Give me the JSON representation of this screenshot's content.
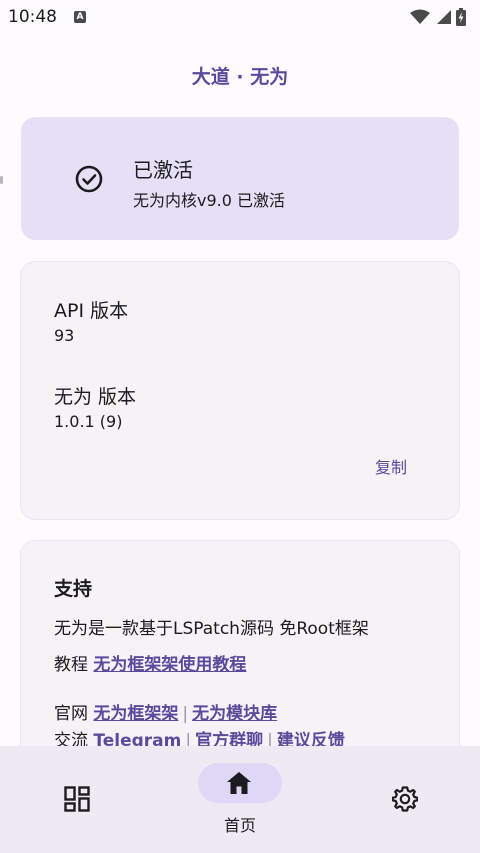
{
  "status_bar": {
    "time": "10:48",
    "notification_icon": "A",
    "icons": [
      "wifi-icon",
      "signal-icon",
      "battery-charging-icon"
    ]
  },
  "app": {
    "title": "大道 · 无为"
  },
  "activation": {
    "title": "已激活",
    "subtitle": "无为内核v9.0 已激活",
    "icon": "check-circle-icon"
  },
  "versions": {
    "api_label": "API 版本",
    "api_value": "93",
    "app_label": "无为 版本",
    "app_value": "1.0.1 (9)",
    "copy_label": "复制"
  },
  "support": {
    "title": "支持",
    "description": "无为是一款基于LSPatch源码 免Root框架",
    "tutorial_prefix": "教程",
    "tutorial_link": "无为框架架使用教程",
    "website_prefix": "官网",
    "website_link_1": "无为框架架",
    "website_link_2": "无为模块库",
    "contact_prefix": "交流",
    "contact_link_1": "Telegram",
    "contact_link_2": "官方群聊",
    "contact_link_3": "建议反馈",
    "separator": "|"
  },
  "bottom_nav": {
    "home_label": "首页",
    "items": [
      "modules-icon",
      "home-icon",
      "settings-icon"
    ]
  },
  "colors": {
    "accent": "#5b4a9c",
    "active_card": "#e6e0f6",
    "card": "#f5f2f8",
    "nav_bg": "#efe9f4",
    "nav_pill": "#e0d6f5"
  }
}
